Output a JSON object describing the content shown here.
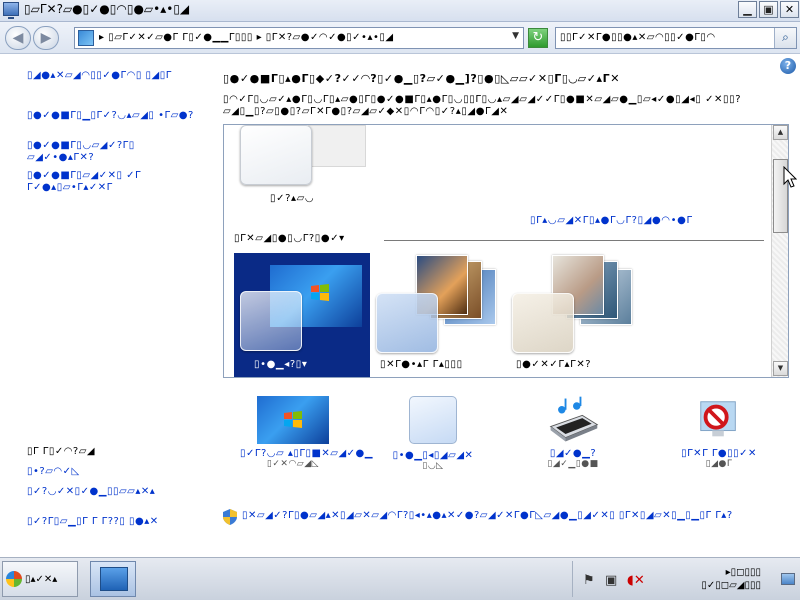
{
  "window": {
    "title": "▯▱Γ✕?▱●▯✓●▯◠▯●▱•▴•▯◢",
    "min_glyph": "▁",
    "max_glyph": "▣",
    "close_glyph": "✕"
  },
  "nav": {
    "back_glyph": "◀",
    "forward_glyph": "▶",
    "address": "▸ ▯▱Γ✓✕✓▱●Γ Γ▯✓●▁▁Γ▯▯▯ ▸ ▯Γ✕?▱●✓◠✓●▯✓•▴•▯◢",
    "refresh_glyph": "↻",
    "search_placeholder": "▯▯Γ✓✕Γ●▯▯●▴✕▱◠▯▯✓●Γ▯◠",
    "search_glyph": "⌕"
  },
  "help_glyph": "?",
  "sidebar": {
    "links": [
      "▯◢●▴✕▱◢◠▯▯✓●Γ◠▯ ▯◢▯Γ",
      "▯●✓●■Γ▯▁▯Γ✓?◡▴▱◢▯ •Γ▱●?",
      "▯●✓●■Γ▯◡▱◢✓?Γ▯ ▱◢✓•●▴Γ✕?",
      "▯●✓●■Γ▯▱◢✓✕▯ ✓Γ Γ✓●▴▯▱•Γ▴✓✕Γ"
    ],
    "see_also": "▯Γ Γ▯✓◠?▱◢",
    "see_also_links": [
      "▯•?▱◠✓◺",
      "▯✓?◡✓✕▯✓●▁▯▯▱▱▴✕▴",
      "▯✓?Γ▯▱▁▯Γ Γ Γ??▯ ▯●▴✕"
    ]
  },
  "main": {
    "title": "▯●✓●■Γ▯▴●Γ▯◆✓?✓✓◠?▯✓●▁▯?▱✓●▁]?▯●▯◺▱▱✓✕▯Γ▯◡▱✓▴Γ✕",
    "description": "▯◠✓Γ▯◡▱✓▴●Γ▯◡Γ▯▴▱●▯Γ▯●✓●■Γ▯▴●Γ▯◡▯▯Γ▯◡▴▱◢▱◢✓✓Γ▯●■✕▱◢▱●▁▯▱◂✓●▯◢◂▯ ✓✕▯▯?▱◢▯▁▯?▱▯●▯?▱Γ✕Γ●▯?▱◢▱✓◆✕▯◠Γ◠▯✓?▴▯◢●Γ◢✕"
  },
  "theme_box": {
    "my_themes_label": "▯✓?▴▱◡",
    "get_more_online": "▯Γ▴◡▱◢✕Γ▯▴●Γ◡Γ?▯◢●◠•●Γ",
    "group_heading": "▯Γ✕▱◢▯●▯◡Γ?▯●✓▾",
    "themes": [
      {
        "name": "▯•●▁◂?▯▾",
        "selected": true
      },
      {
        "name": "▯✕Γ●•▴Γ Γ▴▯▯▯",
        "selected": false
      },
      {
        "name": "▯●✓✕✓Γ▴Γ✕?",
        "selected": false
      }
    ],
    "scroll_up": "▲",
    "scroll_down": "▼"
  },
  "bottom_tiles": [
    {
      "label": "▯✓Γ?◡▱ ▴▯Γ▯■✕▱◢✓●▁",
      "sub": "▯✓✕◠▱◢◺"
    },
    {
      "label": "▯•●▁▯◂▯◢▱◢✕",
      "sub": "▯◡◺"
    },
    {
      "label": "▯◢✓●▁?",
      "sub": "▯◢✓▁▯●■"
    },
    {
      "label": "▯Γ✕Γ Γ●▯▯✓✕",
      "sub": "▯◢●Γ"
    }
  ],
  "uac_link": "▯✕▱◢✓?Γ▯●▱◢▴✕▯◢▱✕▱◢◠Γ?▯◂•▴●▴✕✓●?▱◢✓✕Γ●Γ◺▱◢●▁▯◢✓✕▯ ▯Γ✕▯◢▱✕▯▁▯▁▯Γ Γ▴?",
  "taskbar": {
    "start_label": "▯▴✓✕▴",
    "clock_line1": "▸▯◻▯▯▯",
    "clock_line2": "▯✓▯◻▱◢▯▯▯",
    "tray_icons": [
      "flag-icon",
      "network-icon",
      "volume-muted-icon"
    ]
  },
  "colors": {
    "link": "#0033cc",
    "selection": "#0a2a86",
    "titlebar": "#d7e0ef"
  }
}
